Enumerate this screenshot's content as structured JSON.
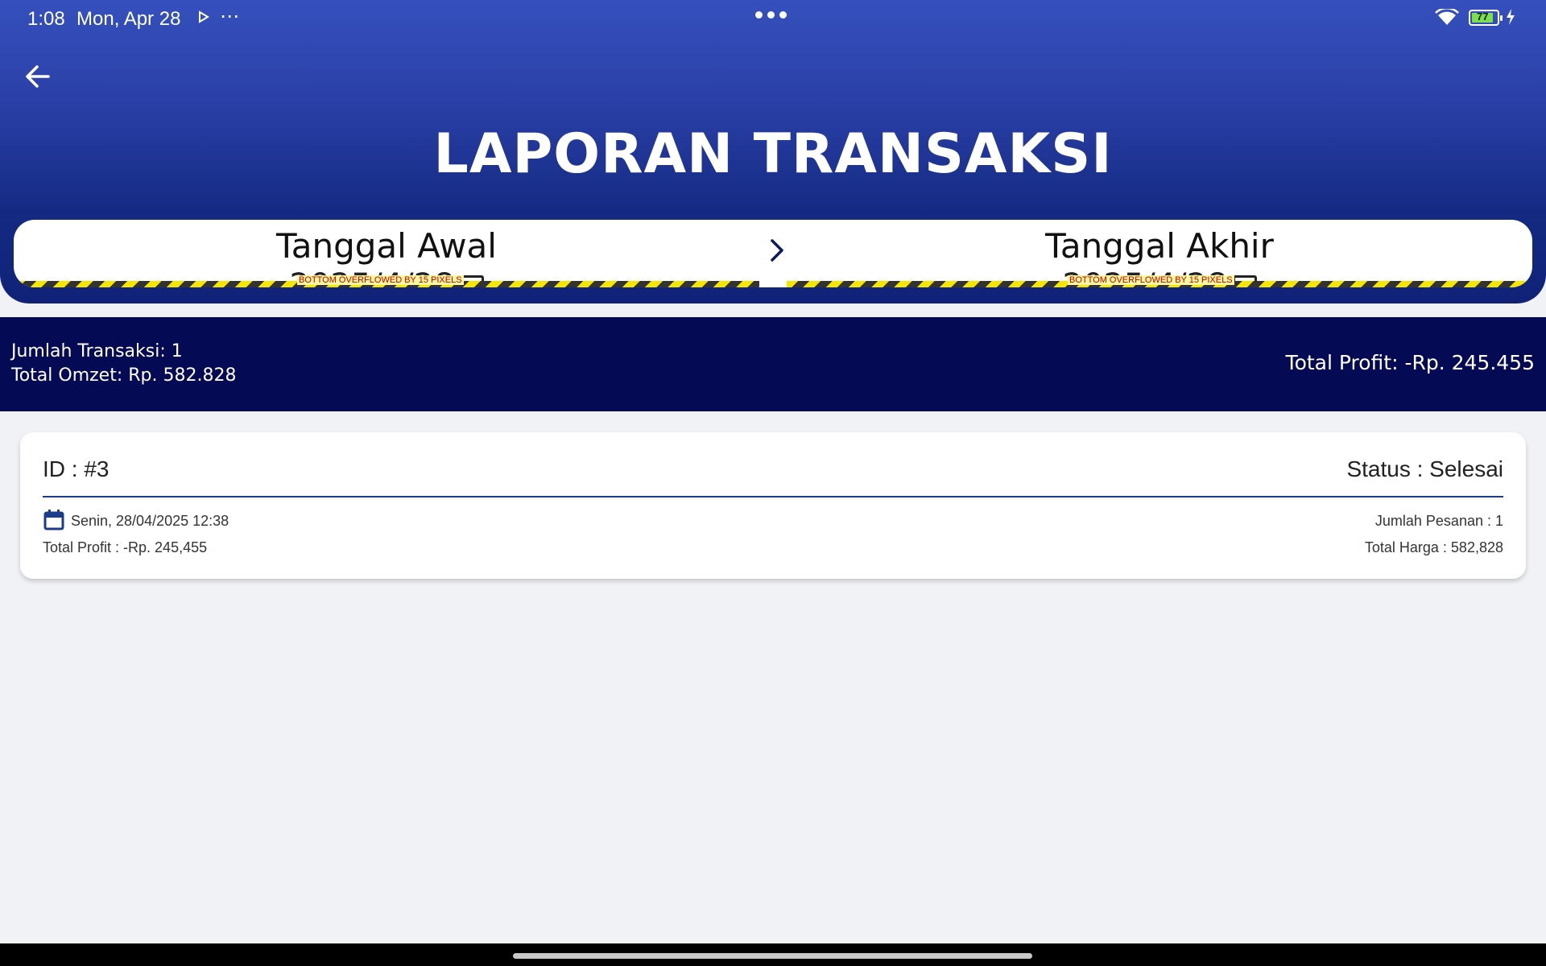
{
  "status_bar": {
    "time": "1:08",
    "date": "Mon, Apr 28",
    "more": "⋯",
    "battery_level": "77",
    "icons": [
      "play-icon",
      "more-icon",
      "wifi-icon",
      "battery-icon",
      "charging-icon"
    ]
  },
  "header": {
    "title": "LAPORAN TRANSAKSI",
    "back_icon": "back-arrow-icon",
    "gradient_top": "#3550bd",
    "gradient_bottom": "#0f2278"
  },
  "date_filter": {
    "start_label": "Tanggal Awal",
    "start_value": "2025/4/28",
    "end_label": "Tanggal Akhir",
    "end_value": "2025/4/28",
    "overflow_warning": "BOTTOM OVERFLOWED BY 15 PIXELS",
    "separator_icon": "chevron-right-icon"
  },
  "summary": {
    "transaction_count": "Jumlah Transaksi: 1",
    "total_omzet": "Total Omzet:  Rp. 582.828",
    "total_profit": "Total Profit: -Rp. 245.455",
    "background": "#050a55"
  },
  "transactions": [
    {
      "id": "ID : #3",
      "status": "Status : Selesai",
      "date": "Senin, 28/04/2025 12:38",
      "profit": "Total Profit : -Rp. 245,455",
      "quantity": "Jumlah Pesanan : 1",
      "price": "Total Harga : 582,828"
    }
  ],
  "colors": {
    "accent": "#1a3c8a",
    "page_background": "#f1f2f6"
  }
}
